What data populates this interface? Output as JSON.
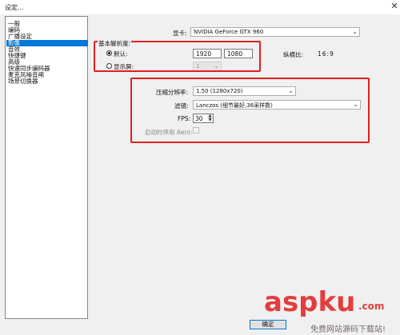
{
  "window": {
    "title": "设定..."
  },
  "sidebar": {
    "items": [
      {
        "label": "一般"
      },
      {
        "label": "编码"
      },
      {
        "label": "广播设定"
      },
      {
        "label": "影像"
      },
      {
        "label": "音效"
      },
      {
        "label": "快捷键"
      },
      {
        "label": "高级"
      },
      {
        "label": "快速同步编码器"
      },
      {
        "label": "麦克风噪音闸"
      },
      {
        "label": "场景切换器"
      }
    ],
    "selected_index": 3
  },
  "video": {
    "gpu_label": "显卡:",
    "gpu_value": "NVIDIA GeForce GTX 960",
    "base_res_label": "基本解析度:",
    "default_label": "默认:",
    "width_value": "1920",
    "height_value": "1080",
    "aspect_label": "纵横比:",
    "aspect_value": "16:9",
    "monitor_label": "显示屏:",
    "monitor_value": "1",
    "downscale_label": "压缩分辨率:",
    "downscale_value": "1.50  (1280x720)",
    "filter_label": "滤镜:",
    "filter_value": "Lanczos (细节最好,36采样数)",
    "fps_label": "FPS:",
    "fps_value": "30",
    "aero_label": "启动时停用 Aero:"
  },
  "footer": {
    "ok_label": "确定"
  },
  "watermark": {
    "brand": "aspku",
    "suffix": ".com",
    "tagline": "免费网站源码下载站!"
  },
  "colors": {
    "selection": "#0078d7",
    "highlight_box": "#e0201e"
  }
}
